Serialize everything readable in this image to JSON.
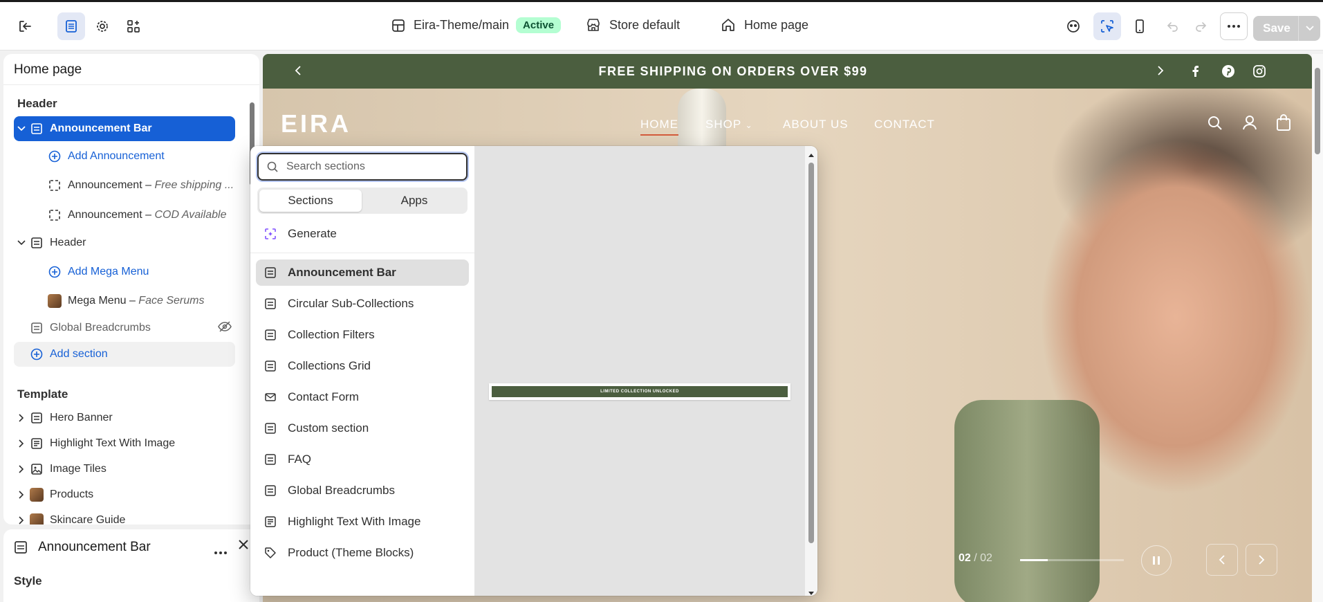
{
  "topbar": {
    "theme_name": "Eira-Theme/main",
    "theme_status": "Active",
    "store_context": "Store default",
    "page_context": "Home page",
    "save_label": "Save"
  },
  "sidebar": {
    "title": "Home page",
    "header_group": "Header",
    "items": [
      {
        "label": "Announcement Bar"
      },
      {
        "label": "Add Announcement"
      },
      {
        "label": "Announcement",
        "detail": "Free shipping ..."
      },
      {
        "label": "Announcement",
        "detail": "COD Available"
      },
      {
        "label": "Header"
      },
      {
        "label": "Add Mega Menu"
      },
      {
        "label": "Mega Menu",
        "detail": "Face Serums"
      },
      {
        "label": "Global Breadcrumbs"
      },
      {
        "label": "Add section"
      }
    ],
    "template_group": "Template",
    "template_items": [
      "Hero Banner",
      "Highlight Text With Image",
      "Image Tiles",
      "Products",
      "Skincare Guide"
    ]
  },
  "props_panel": {
    "title": "Announcement Bar",
    "section_label": "Style"
  },
  "preview": {
    "announcement": "FREE SHIPPING ON ORDERS OVER $99",
    "logo": "EIRA",
    "nav": [
      "HOME",
      "SHOP",
      "ABOUT US",
      "CONTACT"
    ],
    "slide_current": "02",
    "slide_sep": "/",
    "slide_total": "02"
  },
  "picker": {
    "search_placeholder": "Search sections",
    "tabs": [
      "Sections",
      "Apps"
    ],
    "generate_label": "Generate",
    "items": [
      "Announcement Bar",
      "Circular Sub-Collections",
      "Collection Filters",
      "Collections Grid",
      "Contact Form",
      "Custom section",
      "FAQ",
      "Global Breadcrumbs",
      "Highlight Text With Image",
      "Product (Theme Blocks)"
    ],
    "preview_text": "LIMITED COLLECTION UNLOCKED"
  },
  "colors": {
    "accent": "#1660d6",
    "announcement_bg": "#4b5e3f",
    "active_badge": "#b4fed2"
  }
}
